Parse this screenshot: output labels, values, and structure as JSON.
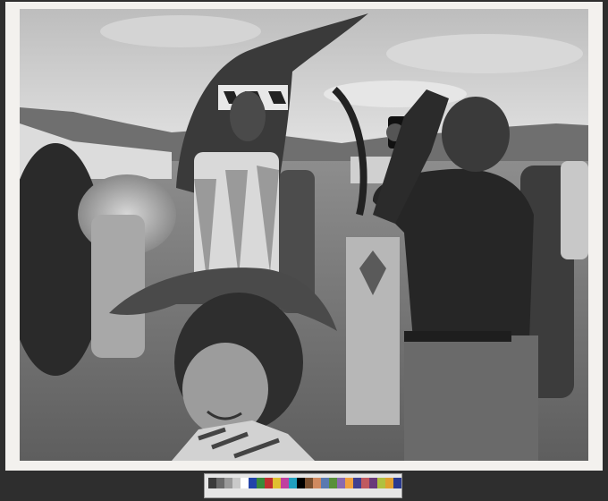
{
  "photo": {
    "tone": "black-and-white",
    "background_color": "#7d7d7d",
    "mount_color": "#f3f1ee"
  },
  "color_target": {
    "patch_colors": [
      "#3b3b3b",
      "#6a6a6a",
      "#9a9a9a",
      "#c9c9c9",
      "#ffffff",
      "#2244aa",
      "#3a8a3a",
      "#c03030",
      "#e0c030",
      "#c040a0",
      "#20a0c0",
      "#000000",
      "#7a5030",
      "#d08a60",
      "#5a7ab0",
      "#58903a",
      "#8a6ab0",
      "#f0a040",
      "#404090",
      "#c05a60",
      "#6a3a7a",
      "#b0c040",
      "#e0a030",
      "#2a3a90"
    ]
  }
}
